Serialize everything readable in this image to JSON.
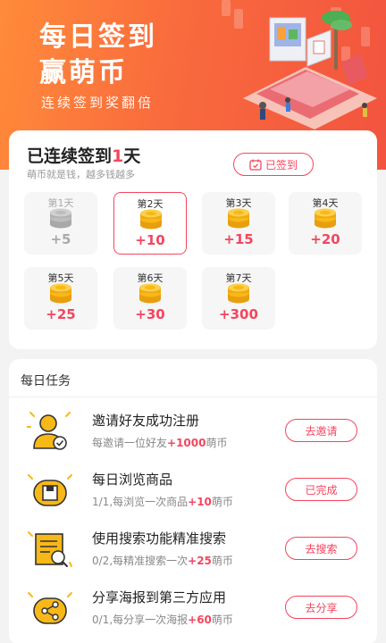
{
  "header": {
    "title_line1": "每日签到",
    "title_line2": "赢萌币",
    "subtitle": "连续签到奖翻倍"
  },
  "checkin": {
    "title_prefix": "已连续签到",
    "streak_days": "1",
    "title_suffix": "天",
    "subtitle": "萌币就是钱，越多钱越多",
    "signed_button": "已签到",
    "days": [
      {
        "label": "第1天",
        "reward": "+5",
        "state": "past"
      },
      {
        "label": "第2天",
        "reward": "+10",
        "state": "active"
      },
      {
        "label": "第3天",
        "reward": "+15",
        "state": "future"
      },
      {
        "label": "第4天",
        "reward": "+20",
        "state": "future"
      },
      {
        "label": "第5天",
        "reward": "+25",
        "state": "future"
      },
      {
        "label": "第6天",
        "reward": "+30",
        "state": "future"
      },
      {
        "label": "第7天",
        "reward": "+300",
        "state": "future"
      }
    ]
  },
  "tasks": {
    "heading": "每日任务",
    "items": [
      {
        "name": "邀请好友成功注册",
        "desc_pre": "每邀请一位好友",
        "points": "+1000",
        "desc_post": "萌币",
        "button": "去邀请",
        "icon": "invite-user-icon"
      },
      {
        "name": "每日浏览商品",
        "desc_pre": "1/1,每浏览一次商品",
        "points": "+10",
        "desc_post": "萌币",
        "button": "已完成",
        "icon": "browse-goods-icon"
      },
      {
        "name": "使用搜索功能精准搜索",
        "desc_pre": "0/2,每精准搜索一次",
        "points": "+25",
        "desc_post": "萌币",
        "button": "去搜索",
        "icon": "search-document-icon"
      },
      {
        "name": "分享海报到第三方应用",
        "desc_pre": "0/1,每分享一次海报",
        "points": "+60",
        "desc_post": "萌币",
        "button": "去分享",
        "icon": "share-icon"
      }
    ]
  },
  "colors": {
    "accent": "#f5455e",
    "header_start": "#ff8b3a",
    "header_end": "#f2543f",
    "coin_gold": "#f8b817",
    "coin_gray": "#bdbdbd"
  }
}
